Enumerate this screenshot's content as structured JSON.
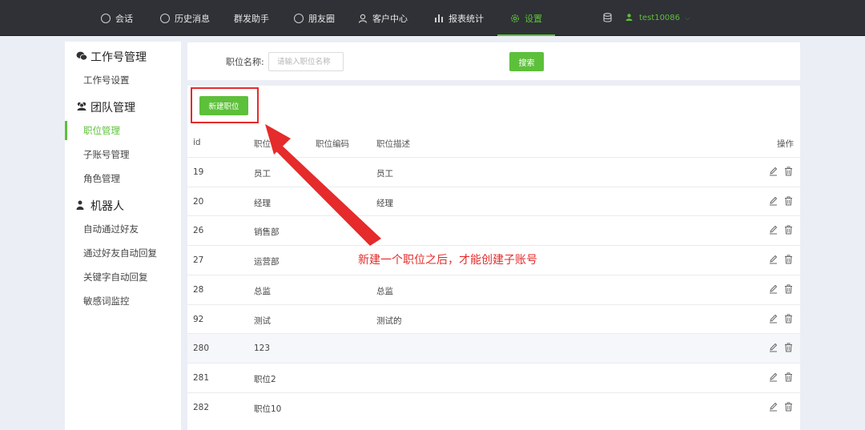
{
  "nav": {
    "items": [
      {
        "label": "会话",
        "icon": "chat-icon"
      },
      {
        "label": "历史消息",
        "icon": "clock-icon"
      },
      {
        "label": "群发助手",
        "icon": ""
      },
      {
        "label": "朋友圈",
        "icon": "aperture-icon"
      },
      {
        "label": "客户中心",
        "icon": "user-icon"
      },
      {
        "label": "报表统计",
        "icon": "bar-chart-icon"
      },
      {
        "label": "设置",
        "icon": "gear-icon",
        "active": true
      }
    ],
    "username": "test10086"
  },
  "sidebar": {
    "groups": [
      {
        "title": "工作号管理",
        "icon": "wechat-icon",
        "items": [
          {
            "label": "工作号设置"
          }
        ]
      },
      {
        "title": "团队管理",
        "icon": "team-icon",
        "items": [
          {
            "label": "职位管理",
            "active": true
          },
          {
            "label": "子账号管理"
          },
          {
            "label": "角色管理"
          }
        ]
      },
      {
        "title": "机器人",
        "icon": "robot-icon",
        "items": [
          {
            "label": "自动通过好友"
          },
          {
            "label": "通过好友自动回复"
          },
          {
            "label": "关键字自动回复"
          },
          {
            "label": "敏感词监控"
          }
        ]
      }
    ]
  },
  "search": {
    "label": "职位名称:",
    "placeholder": "请输入职位名称",
    "value": "",
    "button": "搜索"
  },
  "toolbar": {
    "new_button": "新建职位"
  },
  "table": {
    "headers": {
      "id": "id",
      "name": "职位名",
      "code": "职位编码",
      "desc": "职位描述",
      "ops": "操作"
    },
    "rows": [
      {
        "id": "19",
        "name": "员工",
        "code": "",
        "desc": "员工"
      },
      {
        "id": "20",
        "name": "经理",
        "code": "",
        "desc": "经理"
      },
      {
        "id": "26",
        "name": "销售部",
        "code": "",
        "desc": ""
      },
      {
        "id": "27",
        "name": "运营部",
        "code": "",
        "desc": ""
      },
      {
        "id": "28",
        "name": "总监",
        "code": "",
        "desc": "总监"
      },
      {
        "id": "92",
        "name": "测试",
        "code": "",
        "desc": "测试的"
      },
      {
        "id": "280",
        "name": "123",
        "code": "",
        "desc": "",
        "highlighted": true
      },
      {
        "id": "281",
        "name": "职位2",
        "code": "",
        "desc": ""
      },
      {
        "id": "282",
        "name": "职位10",
        "code": "",
        "desc": ""
      }
    ]
  },
  "annotation": {
    "text": "新建一个职位之后，才能创建子账号",
    "color": "#e52b2b"
  },
  "colors": {
    "accent": "#5dc03a",
    "topbar": "#2f3136",
    "background": "#eceef6"
  }
}
